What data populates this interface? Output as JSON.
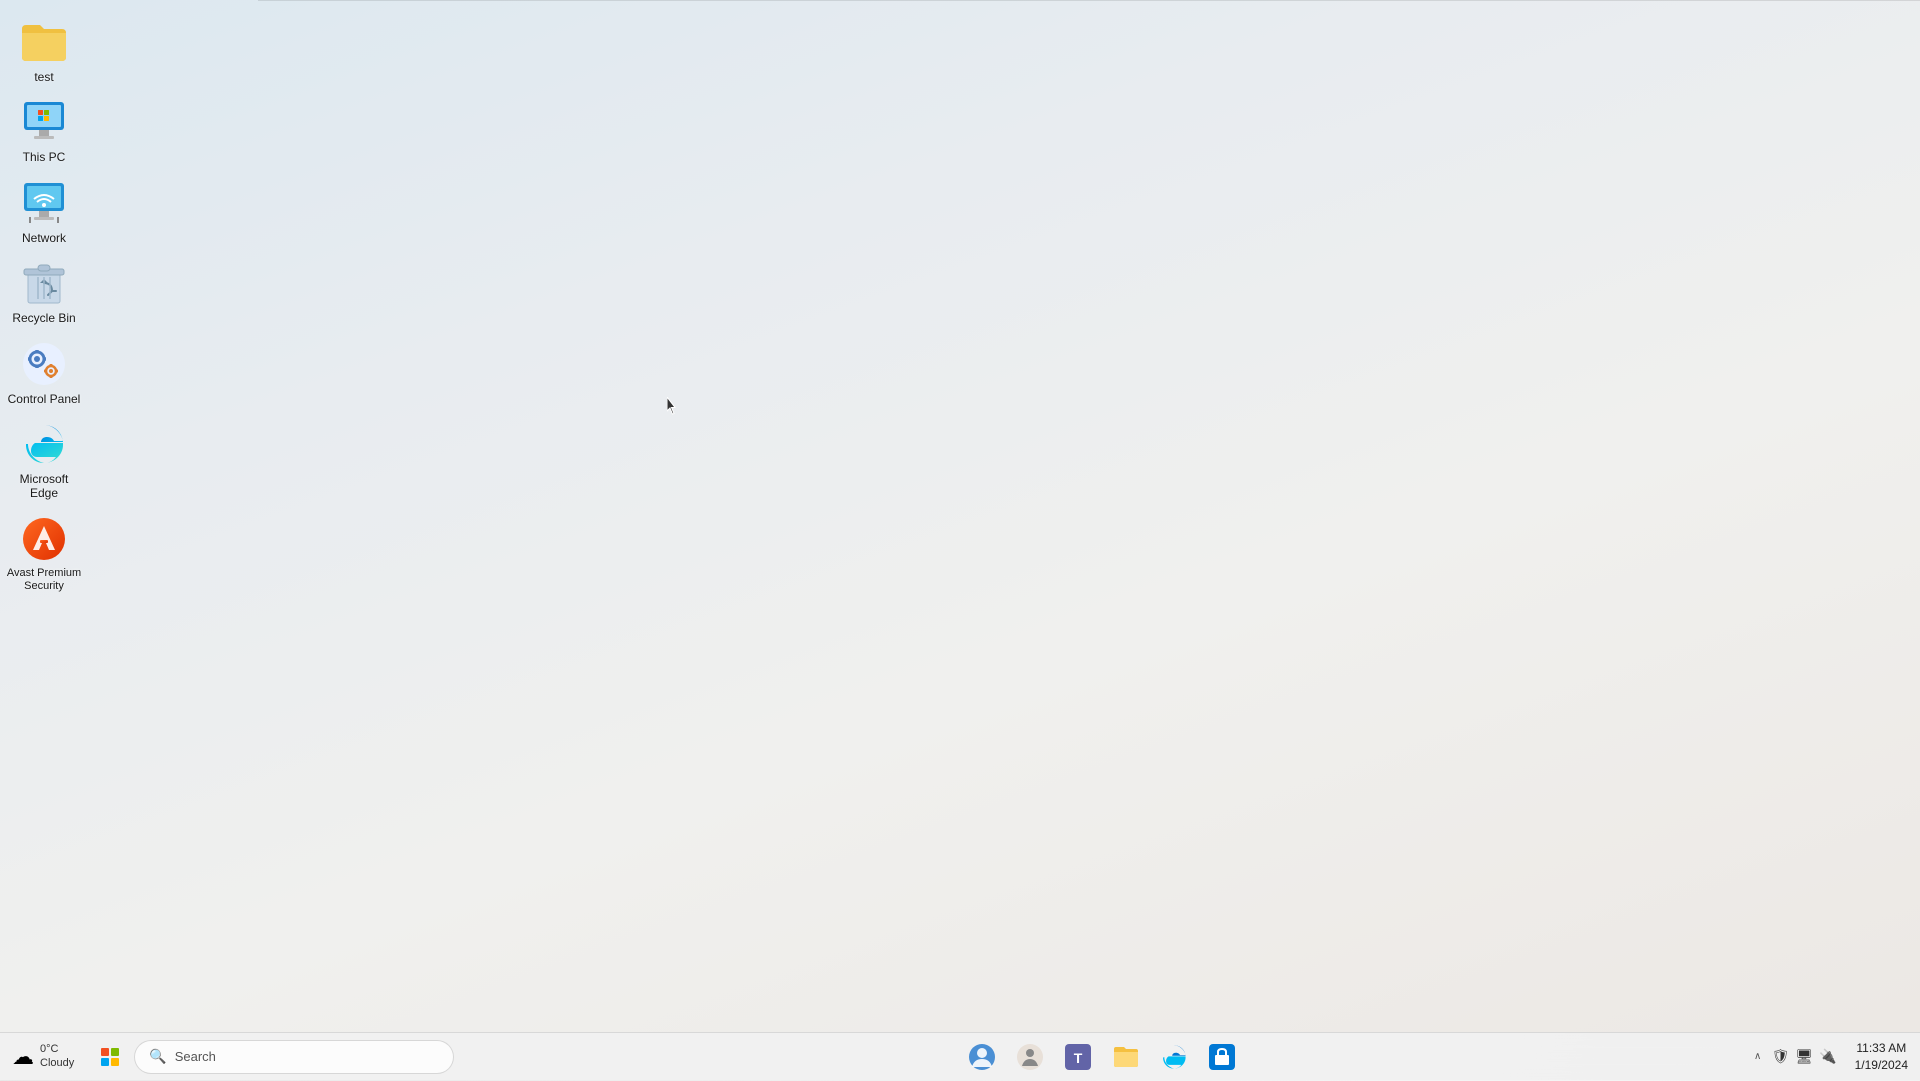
{
  "desktop": {
    "background": "#e8ecf0",
    "icons": [
      {
        "id": "test-folder",
        "label": "test",
        "type": "folder",
        "color": "#f0a830"
      },
      {
        "id": "this-pc",
        "label": "This PC",
        "type": "computer"
      },
      {
        "id": "network",
        "label": "Network",
        "type": "network"
      },
      {
        "id": "recycle-bin",
        "label": "Recycle Bin",
        "type": "recycle"
      },
      {
        "id": "control-panel",
        "label": "Control Panel",
        "type": "controlpanel"
      },
      {
        "id": "microsoft-edge",
        "label": "Microsoft Edge",
        "type": "edge"
      },
      {
        "id": "avast",
        "label": "Avast Premium Security",
        "type": "avast"
      }
    ]
  },
  "taskbar": {
    "weather": {
      "temp": "0°C",
      "condition": "Cloudy"
    },
    "search_placeholder": "Search",
    "apps": [
      {
        "id": "start",
        "label": "Start"
      },
      {
        "id": "search",
        "label": "Search"
      },
      {
        "id": "avatar",
        "label": "User Avatar"
      },
      {
        "id": "app2",
        "label": "App 2"
      },
      {
        "id": "app3",
        "label": "App 3"
      },
      {
        "id": "file-explorer",
        "label": "File Explorer"
      },
      {
        "id": "edge-tb",
        "label": "Microsoft Edge"
      },
      {
        "id": "store",
        "label": "Microsoft Store"
      }
    ],
    "clock": {
      "time": "11:33 AM",
      "date": "1/19/2024"
    }
  }
}
